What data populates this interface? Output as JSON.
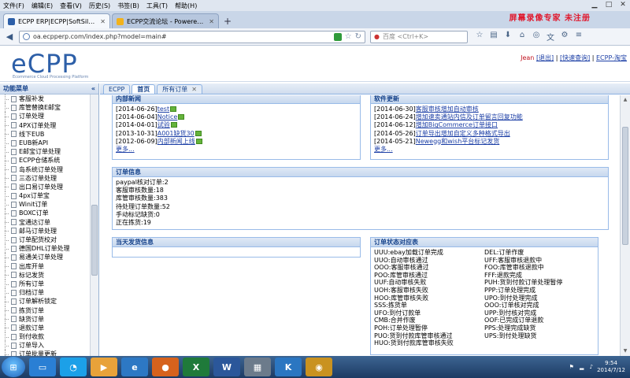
{
  "browser": {
    "menu": [
      "文件(F)",
      "编辑(E)",
      "查看(V)",
      "历史(S)",
      "书签(B)",
      "工具(T)",
      "帮助(H)"
    ],
    "banner": "屏幕录像专家 未注册",
    "tabs": [
      {
        "title": "ECPP ERP|ECPP|SoftSilkRoad...",
        "active": true
      },
      {
        "title": "ECPP交流论坛 - Powered ...",
        "active": false
      }
    ],
    "url": "oa.ecpperp.com/index.php?model=main#",
    "search_placeholder": "百度 <Ctrl+K>"
  },
  "header": {
    "logo": "eCPP",
    "logo_sub": "Ecommerce Cloud Processing Platform",
    "user": "Jean",
    "logout": "[退出]",
    "switch": "[快速查询]",
    "site": "ECPP-淘宝"
  },
  "sidebar": {
    "title": "功能菜单",
    "items": [
      "客服补发",
      "库管替换E邮宝",
      "订单处理",
      "4PX订单处理",
      "线下EUB",
      "EUB新API",
      "E邮宝订单处理",
      "ECPP仓储系统",
      "岛系统订单处理",
      "三态订单处理",
      "出口易订单处理",
      "4px订单宝",
      "Winit订单",
      "BOXC订单",
      "宝通达订单",
      "邮马订单处理",
      "订单配货校对",
      "德国DHL订单处理",
      "易通关订单处理",
      "出库开单",
      "标记发货",
      "所有订单",
      "归档订单",
      "订单解析锁定",
      "拣货订单",
      "缺货订单",
      "退款订单",
      "到付收款",
      "订单导入",
      "订单批量更新"
    ]
  },
  "main_tabs": [
    "ECPP",
    "首页",
    "所有订单"
  ],
  "news": {
    "title": "内部新闻",
    "items": [
      {
        "date": "[2014-06-26]",
        "text": "test"
      },
      {
        "date": "[2014-06-04]",
        "text": "Notice"
      },
      {
        "date": "[2014-04-01]",
        "text": "试验"
      },
      {
        "date": "[2013-10-31]",
        "text": "A001缺货30"
      },
      {
        "date": "[2012-06-09]",
        "text": "内部新闻上线"
      }
    ],
    "more": "更多..."
  },
  "updates": {
    "title": "软件更新",
    "items": [
      {
        "date": "[2014-06-30]",
        "text": "客服审核增加自动审核"
      },
      {
        "date": "[2014-06-24]",
        "text": "增加速卖通站内信及订单留言回复功能"
      },
      {
        "date": "[2014-06-12]",
        "text": "增加BigCommerce订单接口"
      },
      {
        "date": "[2014-05-26]",
        "text": "订单导出增加自定义多种格式导出"
      },
      {
        "date": "[2014-05-21]",
        "text": "Newegg和wish平台标记发货"
      }
    ],
    "more": "更多..."
  },
  "order_info": {
    "title": "订单信息",
    "items": [
      "paypal核对订单:2",
      "客服审核数量:18",
      "库管审核数量:383",
      "待处理订单数量:52",
      "手动标记缺货:0",
      "正在拣货:19"
    ]
  },
  "today_ship": {
    "title": "当天发货信息"
  },
  "status_defs": {
    "title": "订单状态对应表",
    "left": [
      "UUU:ebay加载订单完成",
      "UUO:自动审核通过",
      "OOO:客服审核通过",
      "POO:库管审核通过",
      "UUF:自动审核失败",
      "UOH:客服审核失败",
      "HOO:库管审核失败",
      "SSS:拣货单",
      "UFO:到付订款单",
      "CMB:合并作废",
      "POH:订单处理暂停",
      "PUO:货到付款库管审核通过",
      "HUO:货到付款库管审核失败"
    ],
    "right": [
      "DEL:订单作废",
      "UFF:客服审核退款中",
      "FOO:库管审核退款中",
      "FFF:退款完成",
      "PUH:货到付款订单处理暂停",
      "PPP:订单处理完成",
      "UPO:到付处理完成",
      "OOO:订单核对完成",
      "UPP:到付核对完成",
      "OOF:已完成订单退款",
      "PPS:处理完成缺货",
      "UPS:到付处理缺货"
    ]
  },
  "taskbar": {
    "time": "9:54",
    "date": "2014/7/12"
  }
}
